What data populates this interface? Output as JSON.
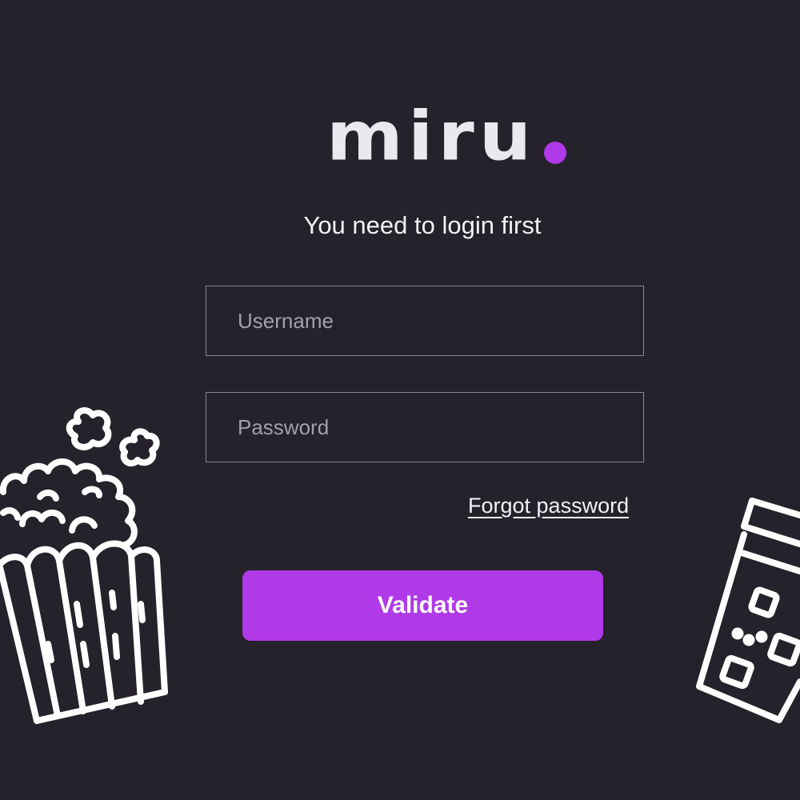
{
  "logo": {
    "text": "miru"
  },
  "subtitle": "You need to login first",
  "username": {
    "placeholder": "Username"
  },
  "password": {
    "placeholder": "Password"
  },
  "forgot_label": "Forgot password",
  "validate_label": "Validate",
  "colors": {
    "background": "#25222b",
    "accent": "#b03ae8",
    "line": "#ffffff"
  },
  "icons": {
    "left_decoration": "popcorn-icon",
    "right_decoration": "soda-cup-icon"
  }
}
